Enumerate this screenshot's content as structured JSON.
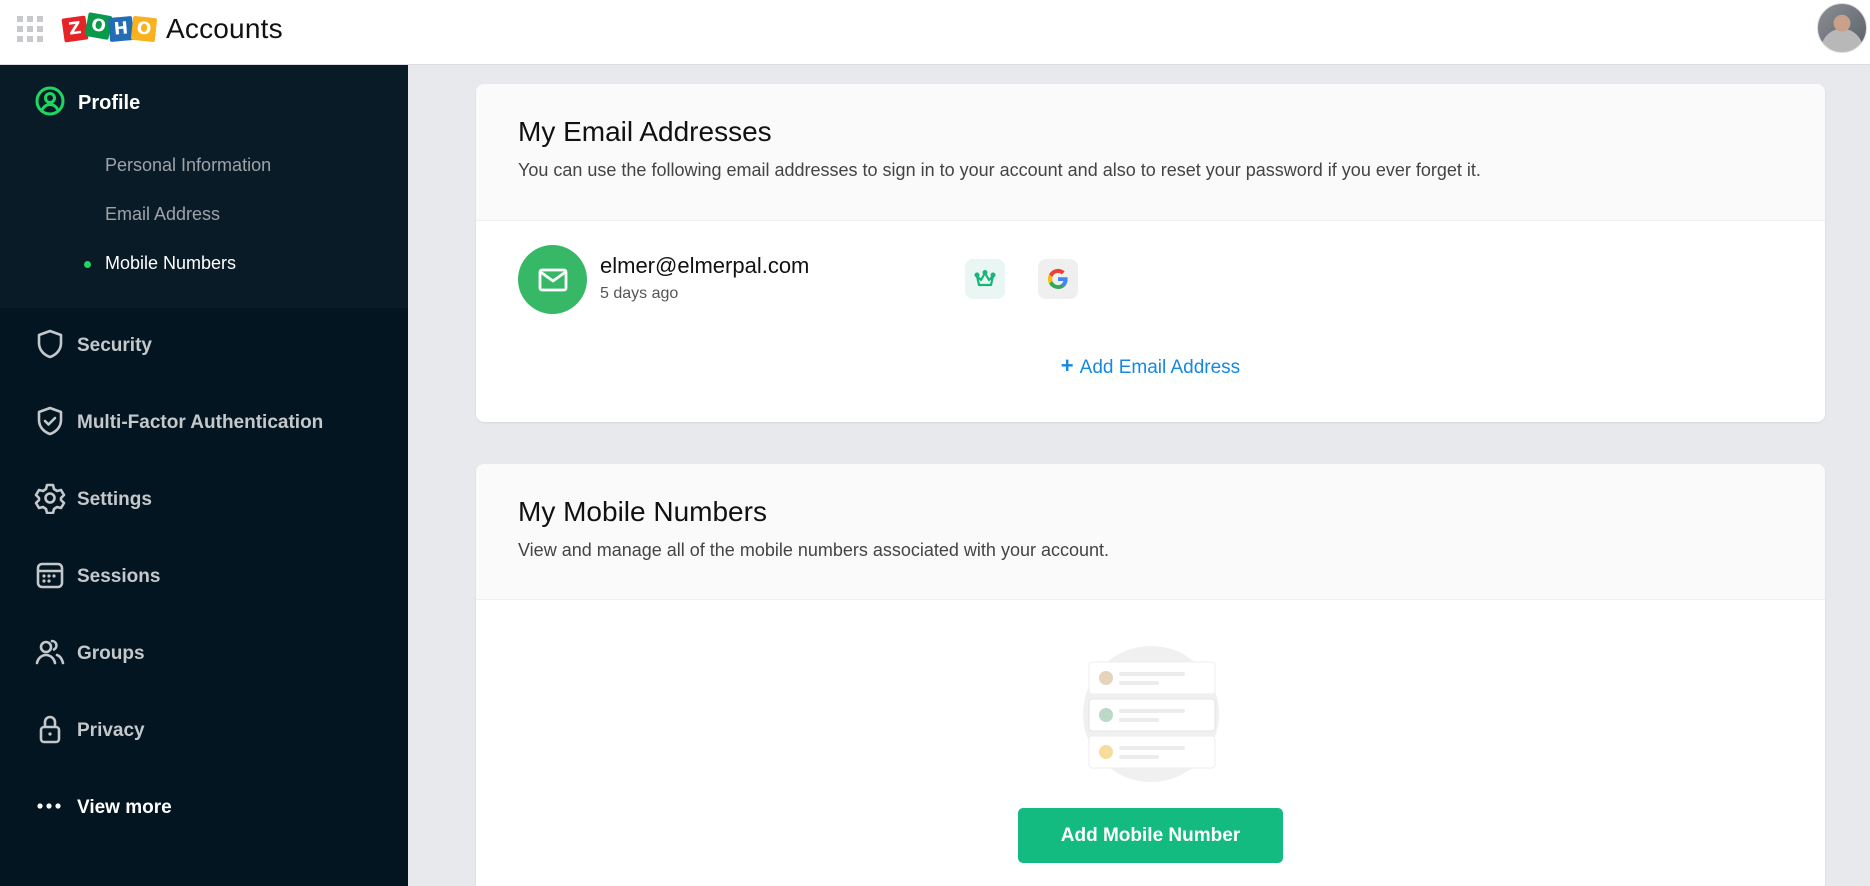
{
  "header": {
    "app_title": "Accounts",
    "logo_letters": [
      "Z",
      "O",
      "H",
      "O"
    ],
    "avatar_alt": "User avatar"
  },
  "sidebar": {
    "profile": {
      "label": "Profile",
      "sub_items": [
        {
          "label": "Personal Information",
          "active": false
        },
        {
          "label": "Email Address",
          "active": false
        },
        {
          "label": "Mobile Numbers",
          "active": true
        }
      ]
    },
    "items": [
      {
        "label": "Security",
        "icon": "shield-icon"
      },
      {
        "label": "Multi-Factor Authentication",
        "icon": "shield-check-icon"
      },
      {
        "label": "Settings",
        "icon": "gear-icon"
      },
      {
        "label": "Sessions",
        "icon": "calendar-icon"
      },
      {
        "label": "Groups",
        "icon": "users-icon"
      },
      {
        "label": "Privacy",
        "icon": "lock-icon"
      },
      {
        "label": "View more",
        "icon": "ellipsis-icon"
      }
    ]
  },
  "email_section": {
    "title": "My Email Addresses",
    "description": "You can use the following email addresses to sign in to your account and also to reset your password if you ever forget it.",
    "emails": [
      {
        "address": "elmer@elmerpal.com",
        "added": "5 days ago",
        "badges": [
          "primary-crown",
          "google"
        ]
      }
    ],
    "add_label": "Add Email Address",
    "add_icon": "+"
  },
  "mobile_section": {
    "title": "My Mobile Numbers",
    "description": "View and manage all of the mobile numbers associated with your account.",
    "add_button_label": "Add Mobile Number"
  },
  "colors": {
    "accent_green": "#13bb80",
    "profile_green": "#1ed760",
    "link_blue": "#1589e0",
    "sidebar_bg": "#021520",
    "main_bg": "#e8e9ed"
  }
}
